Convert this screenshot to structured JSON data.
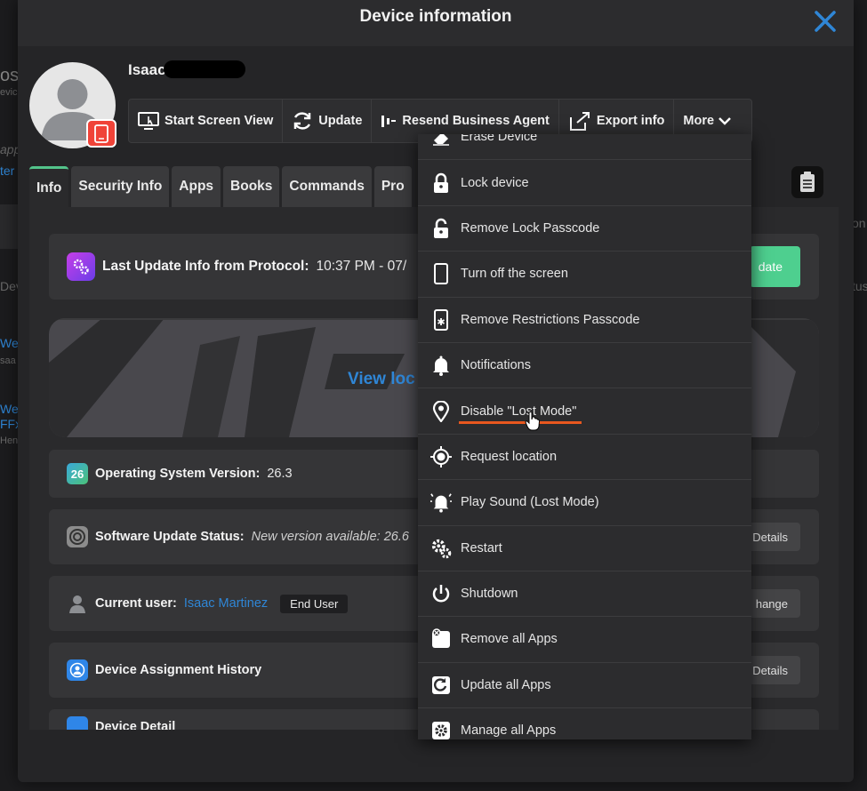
{
  "modal": {
    "title": "Device information"
  },
  "user": {
    "name": "Isaac"
  },
  "actions": [
    {
      "label": "Start Screen View",
      "icon": "screen-view-icon"
    },
    {
      "label": "Update",
      "icon": "refresh-icon"
    },
    {
      "label": "Resend Business Agent",
      "icon": "agent-icon"
    },
    {
      "label": "Export info",
      "icon": "export-icon"
    },
    {
      "label": "More",
      "icon": "chevron-down-icon"
    }
  ],
  "tabs": [
    "Info",
    "Security Info",
    "Apps",
    "Books",
    "Commands",
    "Pro"
  ],
  "info": {
    "last_update_label": "Last Update Info from Protocol:",
    "last_update_value": "10:37 PM - 07/",
    "update_button": "date",
    "map_link": "View loc",
    "os_label": "Operating System Version:",
    "os_value": "26.3",
    "os_badge": "26",
    "sw_label": "Software Update Status:",
    "sw_value": "New version available: 26.6",
    "sw_button": "Details",
    "user_label": "Current user:",
    "user_value": "Isaac Martinez",
    "user_role": "End User",
    "user_button": "hange",
    "history_label": "Device Assignment History",
    "history_button": "Details",
    "details_label": "Device Detail"
  },
  "menu": [
    {
      "label": "Erase Device",
      "icon": "eraser-icon"
    },
    {
      "label": "Lock device",
      "icon": "lock-icon"
    },
    {
      "label": "Remove Lock Passcode",
      "icon": "unlock-icon"
    },
    {
      "label": "Turn off the screen",
      "icon": "phone-moon-icon"
    },
    {
      "label": "Remove Restrictions Passcode",
      "icon": "phone-asterisk-icon"
    },
    {
      "label": "Notifications",
      "icon": "bell-icon"
    },
    {
      "label": "Disable \"Lost Mode\"",
      "icon": "map-pin-icon"
    },
    {
      "label": "Request location",
      "icon": "target-icon"
    },
    {
      "label": "Play Sound (Lost Mode)",
      "icon": "bell-sound-icon"
    },
    {
      "label": "Restart",
      "icon": "gears-icon"
    },
    {
      "label": "Shutdown",
      "icon": "power-icon"
    },
    {
      "label": "Remove all Apps",
      "icon": "remove-apps-icon"
    },
    {
      "label": "Update all Apps",
      "icon": "update-apps-icon"
    },
    {
      "label": "Manage all Apps",
      "icon": "manage-apps-icon"
    }
  ],
  "background": {
    "texts": [
      "os",
      "evic",
      "app",
      "ter",
      "Dev",
      "We",
      "saa",
      "We",
      "FFx",
      "Hen",
      "on",
      "tus"
    ]
  },
  "colors": {
    "accent": "#e8571f",
    "link": "#2f86d6",
    "active_tab": "#53c48b",
    "badge": "#f04338"
  }
}
